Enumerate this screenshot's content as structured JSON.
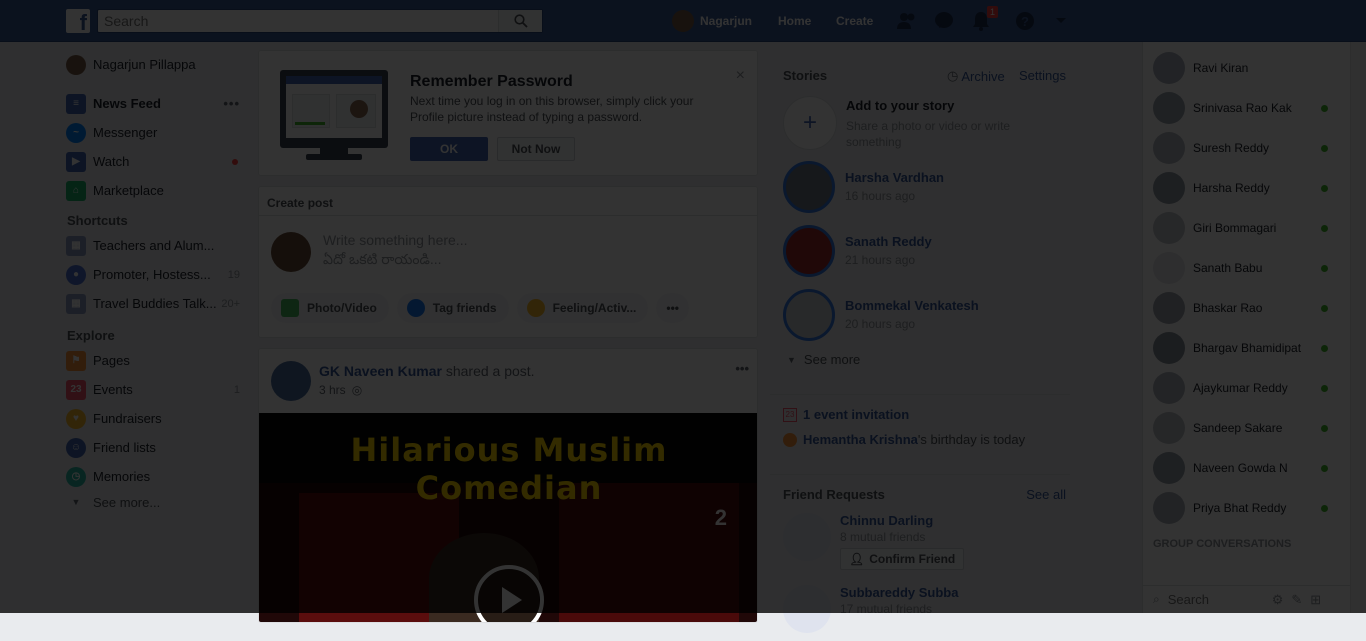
{
  "topbar": {
    "logo": "f",
    "search_placeholder": "Search",
    "user_name": "Nagarjun",
    "home": "Home",
    "create": "Create",
    "notification_count": "1",
    "brand_color": "#3b5998"
  },
  "leftnav": {
    "profile_name": "Nagarjun Pillappa",
    "items": [
      {
        "label": "News Feed",
        "icon": "news-feed-icon",
        "color": "#4267b2"
      },
      {
        "label": "Messenger",
        "icon": "messenger-icon",
        "color": "#0084ff"
      },
      {
        "label": "Watch",
        "icon": "watch-icon",
        "color": "#4267b2"
      },
      {
        "label": "Marketplace",
        "icon": "marketplace-icon",
        "color": "#19b56b"
      }
    ],
    "shortcuts_title": "Shortcuts",
    "shortcuts": [
      {
        "label": "Teachers and Alum...",
        "count": ""
      },
      {
        "label": "Promoter, Hostess...",
        "count": "19"
      },
      {
        "label": "Travel Buddies Talk...",
        "count": "20+"
      }
    ],
    "explore_title": "Explore",
    "explore": [
      {
        "label": "Pages",
        "count": ""
      },
      {
        "label": "Events",
        "count": "1"
      },
      {
        "label": "Fundraisers",
        "count": ""
      },
      {
        "label": "Friend lists",
        "count": ""
      },
      {
        "label": "Memories",
        "count": ""
      }
    ],
    "see_more": "See more..."
  },
  "remember": {
    "title": "Remember Password",
    "body": "Next time you log in on this browser, simply click your Profile picture instead of typing a password.",
    "ok": "OK",
    "not_now": "Not Now"
  },
  "create_post": {
    "title": "Create post",
    "placeholder": "Write something here...",
    "placeholder2": "ఏదో ఒకటి రాయండి...",
    "photo": "Photo/Video",
    "tag": "Tag friends",
    "feeling": "Feeling/Activ..."
  },
  "post": {
    "author": "GK Naveen Kumar",
    "action": "shared a post.",
    "time": "3 hrs",
    "video_title": "Hilarious Muslim Comedian",
    "video_badge": "2"
  },
  "stories": {
    "title": "Stories",
    "archive": "Archive",
    "settings": "Settings",
    "add_title": "Add to your story",
    "add_sub": "Share a photo or video or write something",
    "items": [
      {
        "name": "Harsha Vardhan",
        "time": "16 hours ago"
      },
      {
        "name": "Sanath Reddy",
        "time": "21 hours ago"
      },
      {
        "name": "Bommekal Venkatesh",
        "time": "20 hours ago"
      }
    ],
    "see_more": "See more"
  },
  "events": {
    "invitation": "1 event invitation",
    "birthday_name": "Hemantha Krishna",
    "birthday_text": "'s birthday is today"
  },
  "friend_requests": {
    "title": "Friend Requests",
    "see_all": "See all",
    "items": [
      {
        "name": "Chinnu Darling",
        "mutual": "8 mutual friends",
        "confirm": "Confirm Friend"
      },
      {
        "name": "Subbareddy Subba",
        "mutual": "17 mutual friends"
      }
    ]
  },
  "chat": {
    "contacts": [
      "Ravi Kiran",
      "Srinivasa Rao Kak",
      "Suresh Reddy",
      "Harsha Reddy",
      "Giri Bommagari",
      "Sanath Babu",
      "Bhaskar Rao",
      "Bhargav Bhamidipat",
      "Ajaykumar Reddy",
      "Sandeep Sakare",
      "Naveen Gowda N",
      "Priya Bhat Reddy"
    ],
    "group_label": "GROUP CONVERSATIONS",
    "search_placeholder": "Search"
  }
}
